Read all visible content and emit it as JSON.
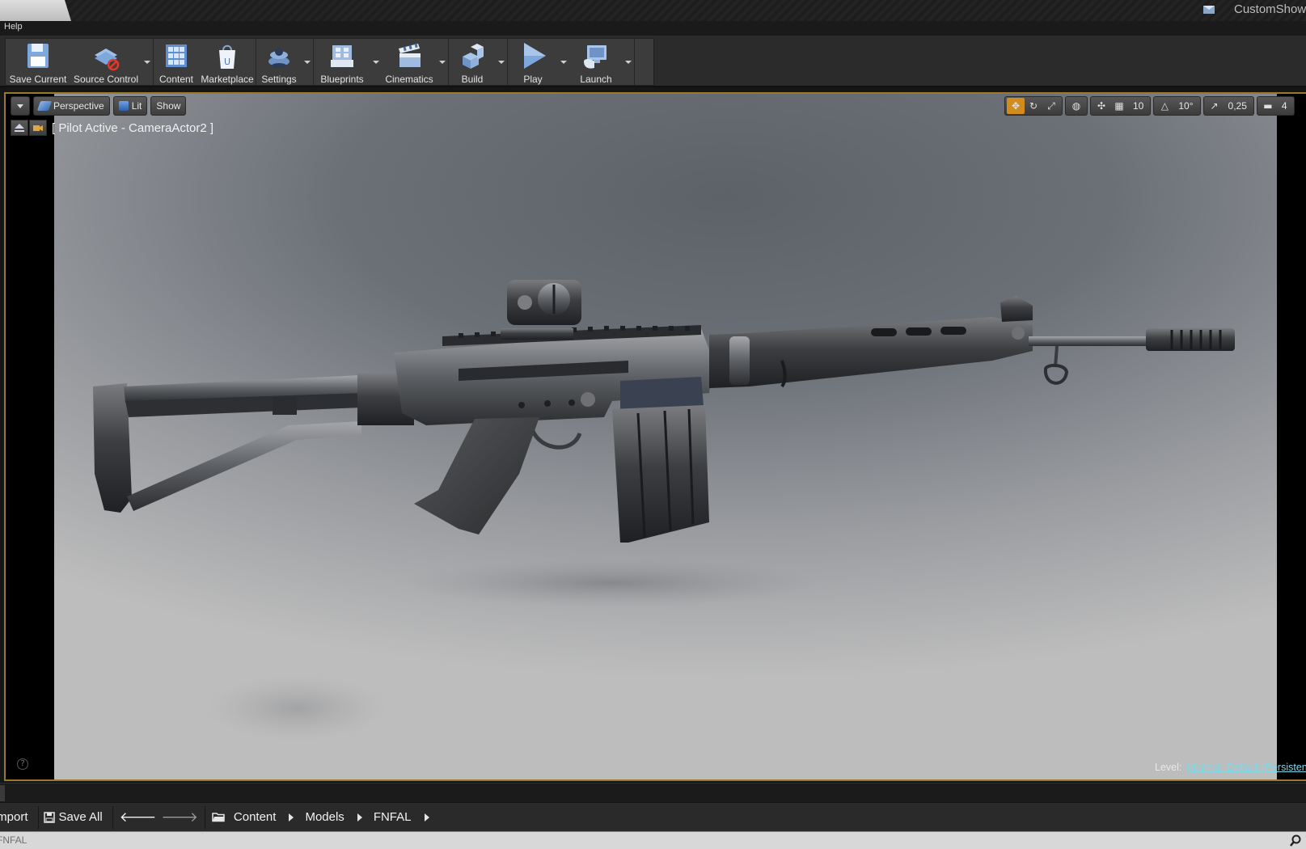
{
  "titlebar": {
    "project_name": "CustomShow"
  },
  "menubar": {
    "items": [
      "Help"
    ]
  },
  "toolbar": {
    "buttons": [
      {
        "label": "Save Current",
        "icon": "save-icon"
      },
      {
        "label": "Source Control",
        "icon": "source-control-icon"
      },
      {
        "label": "Content",
        "icon": "content-icon"
      },
      {
        "label": "Marketplace",
        "icon": "marketplace-icon"
      },
      {
        "label": "Settings",
        "icon": "settings-icon"
      },
      {
        "label": "Blueprints",
        "icon": "blueprints-icon"
      },
      {
        "label": "Cinematics",
        "icon": "cinematics-icon"
      },
      {
        "label": "Build",
        "icon": "build-icon"
      },
      {
        "label": "Play",
        "icon": "play-icon"
      },
      {
        "label": "Launch",
        "icon": "launch-icon"
      }
    ]
  },
  "viewport": {
    "view_mode": "Perspective",
    "lighting": "Lit",
    "show": "Show",
    "pilot_text": "[ Pilot Active - CameraActor2 ]",
    "grid_snap": "10",
    "rotation_snap": "10°",
    "scale_snap": "0,25",
    "camera_speed": "4",
    "level_label": "Level:",
    "level_name": "Minimal_Default (Persistent)",
    "help": "?"
  },
  "content_browser": {
    "import_label": "Import",
    "save_all_label": "Save All",
    "path": [
      "Content",
      "Models",
      "FNFAL"
    ],
    "filter_text": "FNFAL"
  },
  "colors": {
    "accent": "#d28c1e",
    "viewport_border": "#9a7a2a",
    "level_link": "#7fd9e6"
  }
}
